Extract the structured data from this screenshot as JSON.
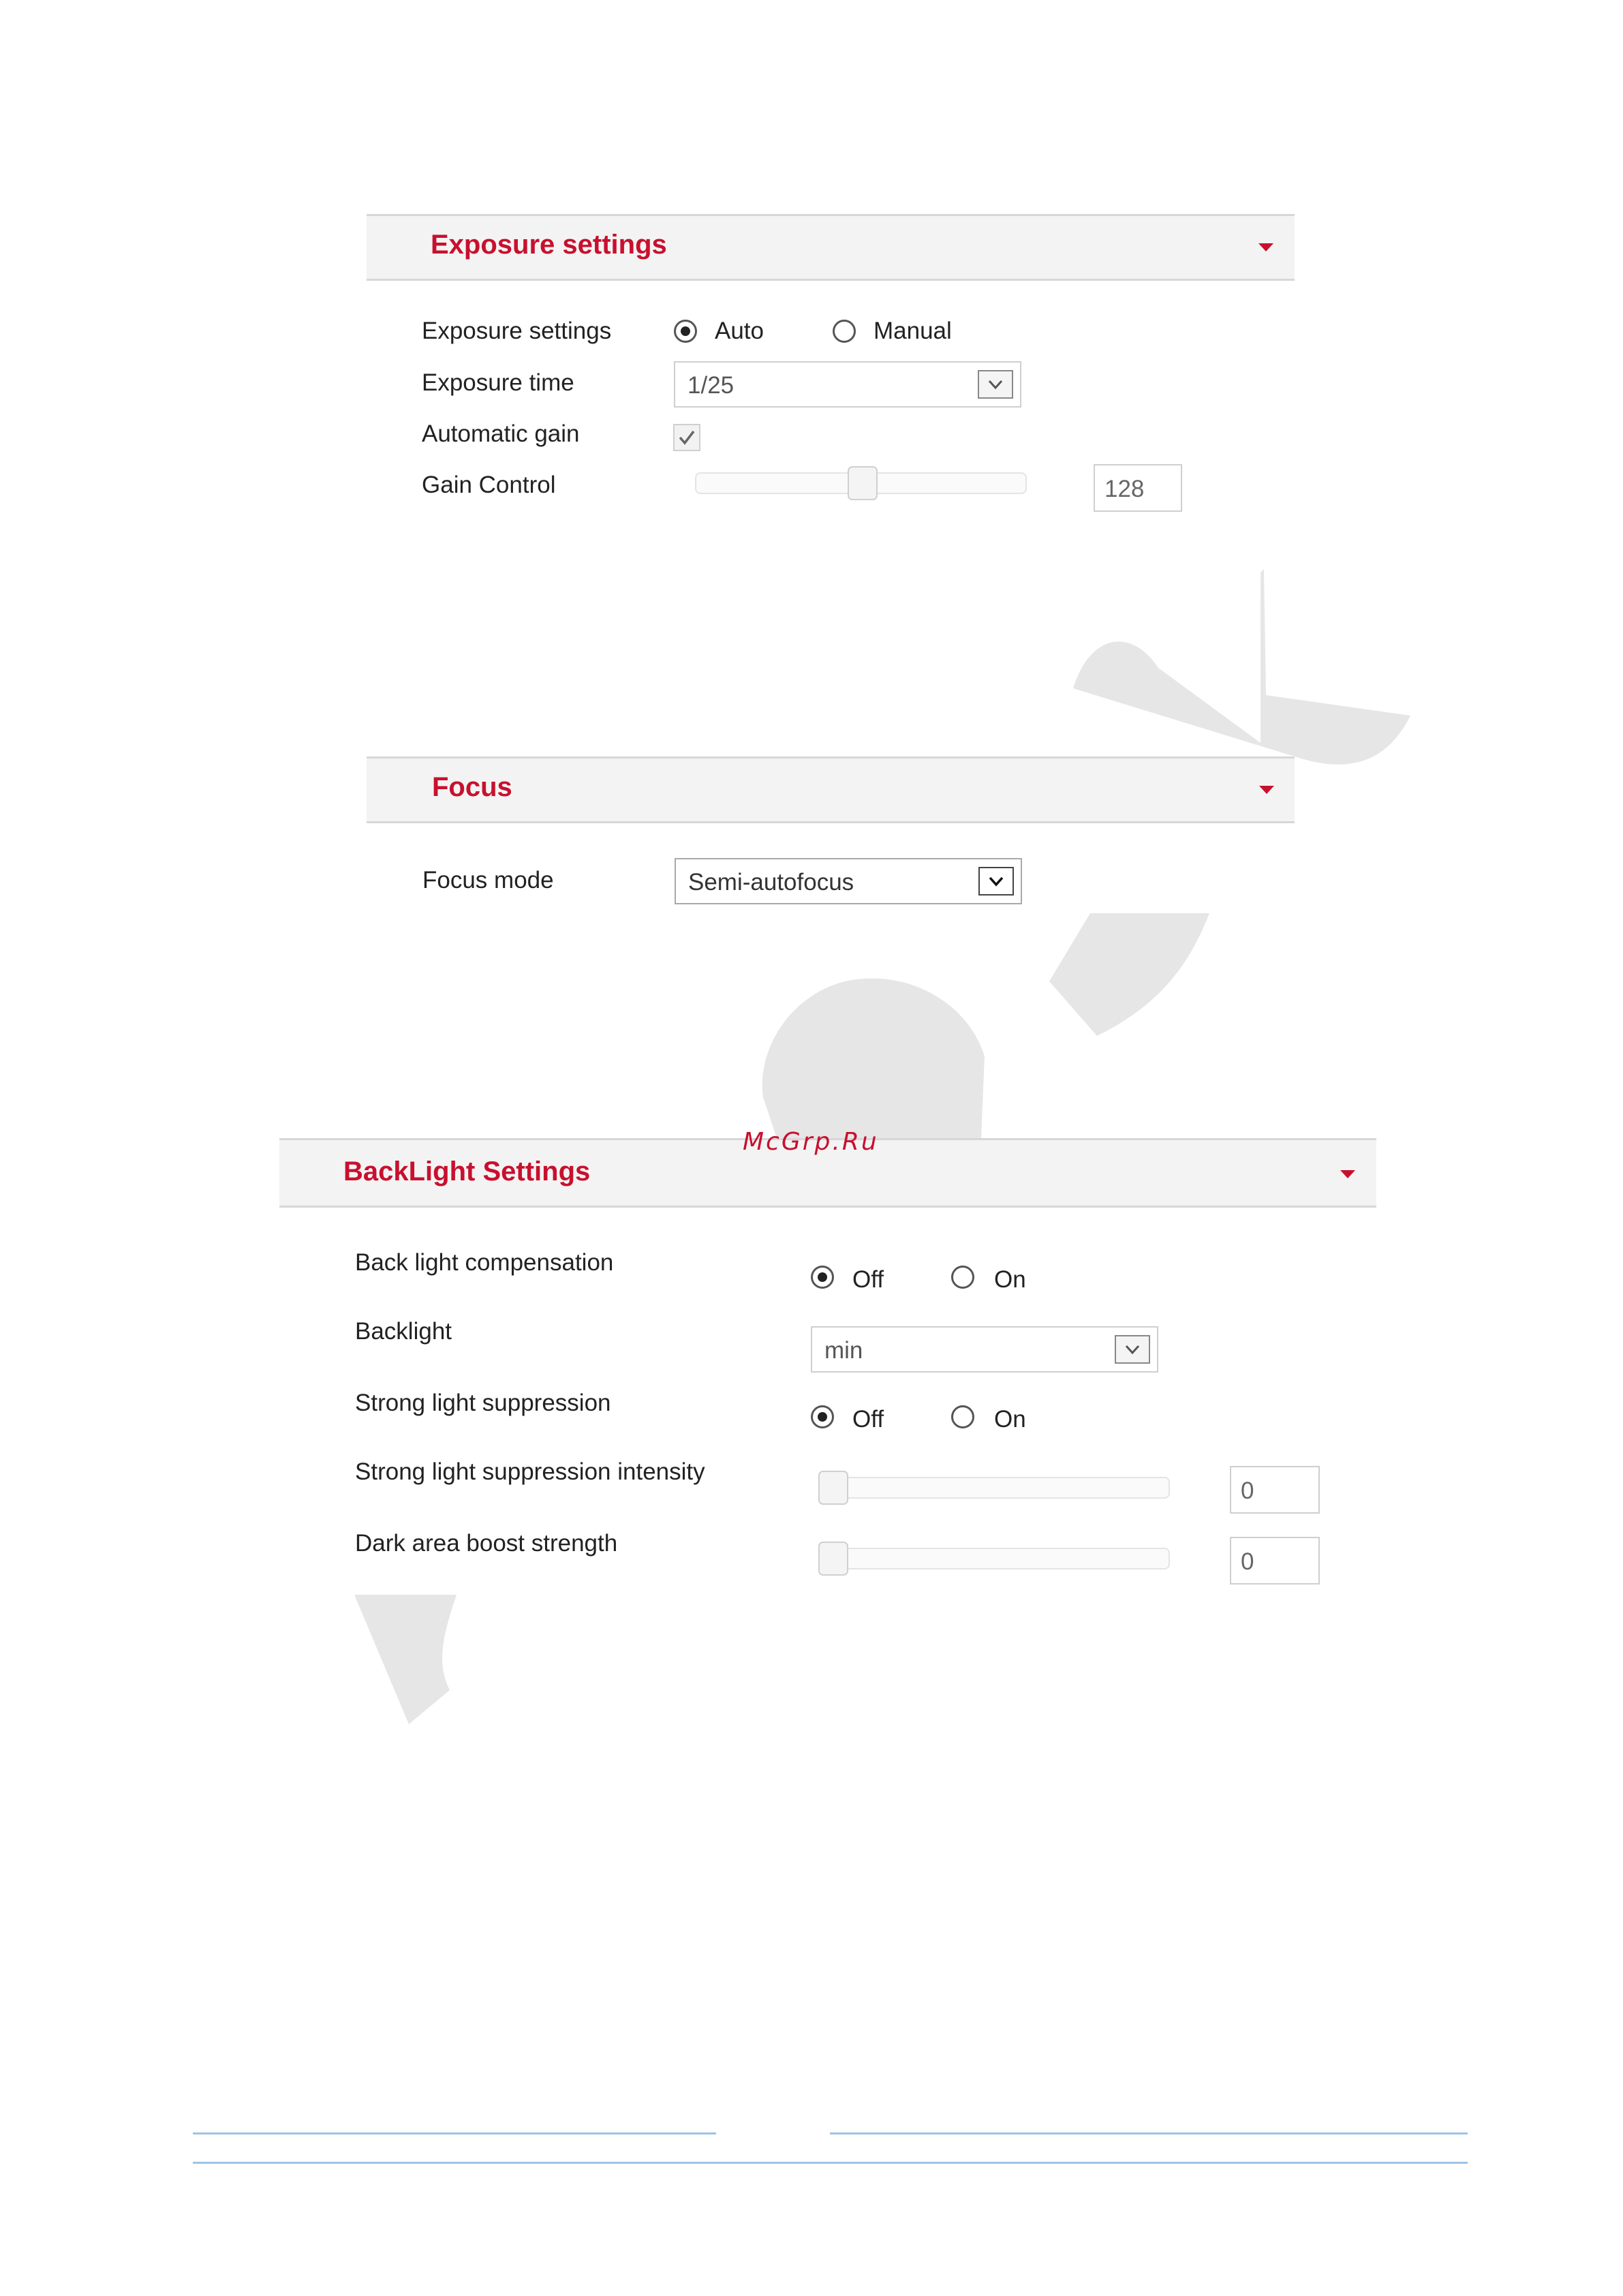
{
  "watermark": {
    "text": "McGrp.Ru"
  },
  "colors": {
    "accent": "#c8102e",
    "header_bg": "#f3f3f3",
    "footer_rule": "#9dc3e6"
  },
  "exposure": {
    "title": "Exposure settings",
    "collapse_icon": "caret-down-icon",
    "exposure_mode": {
      "label": "Exposure settings",
      "options": [
        "Auto",
        "Manual"
      ],
      "selected": "Auto"
    },
    "exposure_time": {
      "label": "Exposure time",
      "value": "1/25"
    },
    "automatic_gain": {
      "label": "Automatic gain",
      "checked": true
    },
    "gain_control": {
      "label": "Gain Control",
      "value": "128",
      "level_fraction": 0.5
    }
  },
  "focus": {
    "title": "Focus",
    "collapse_icon": "caret-down-icon",
    "focus_mode": {
      "label": "Focus mode",
      "value": "Semi-autofocus"
    }
  },
  "backlight": {
    "title": "BackLight Settings",
    "collapse_icon": "caret-down-icon",
    "back_light_compensation": {
      "label": "Back light compensation",
      "options": [
        "Off",
        "On"
      ],
      "selected": "Off"
    },
    "backlight": {
      "label": "Backlight",
      "value": "min"
    },
    "strong_light_suppression": {
      "label": "Strong light suppression",
      "options": [
        "Off",
        "On"
      ],
      "selected": "Off"
    },
    "strong_light_suppression_intensity": {
      "label": "Strong light suppression intensity",
      "value": "0",
      "level_fraction": 0
    },
    "dark_area_boost_strength": {
      "label": "Dark area boost strength",
      "value": "0",
      "level_fraction": 0
    }
  }
}
